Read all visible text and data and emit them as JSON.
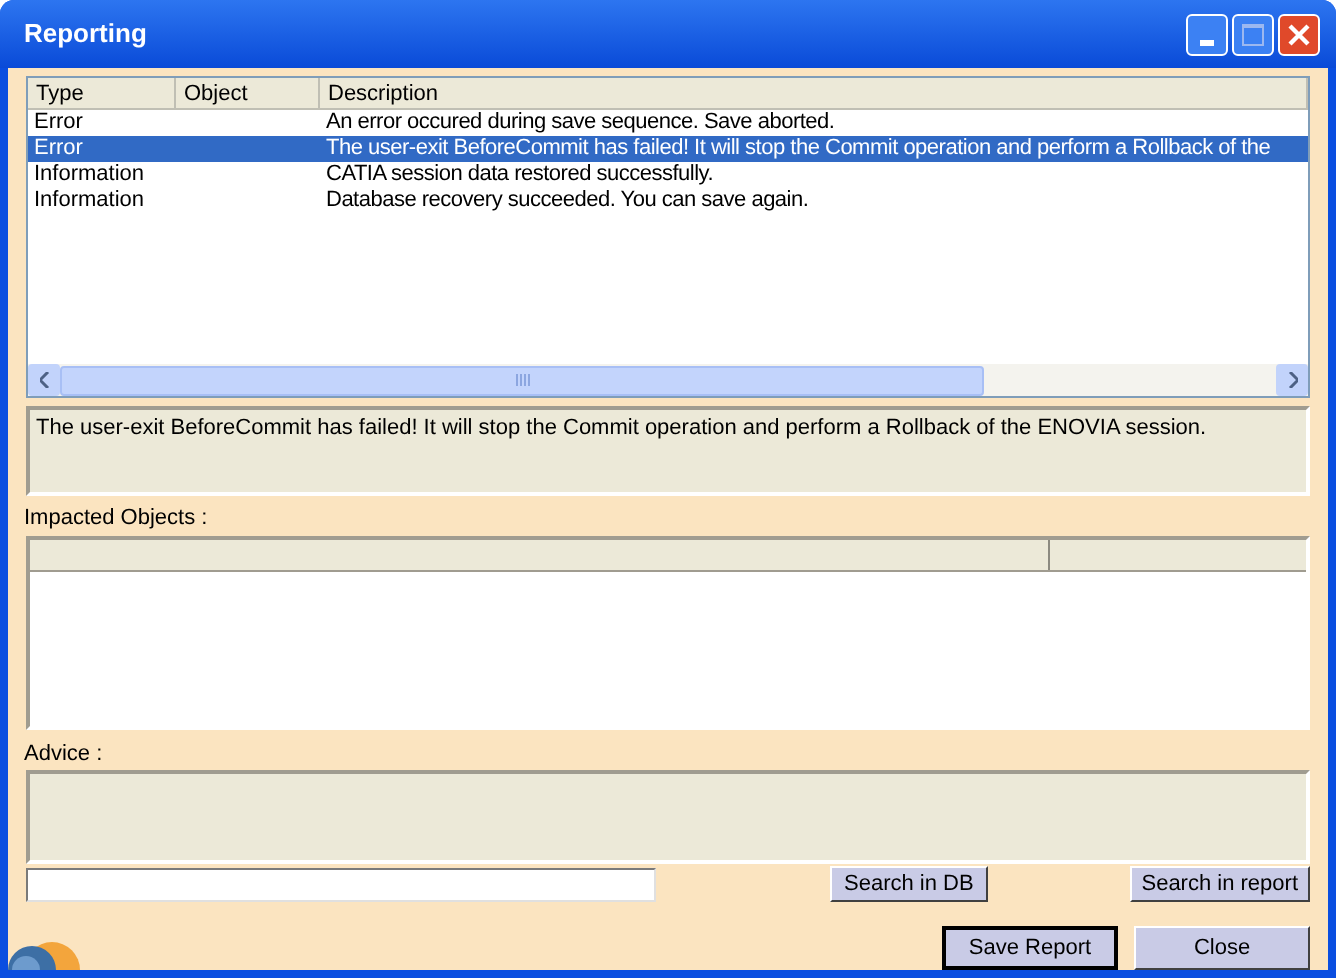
{
  "window": {
    "title": "Reporting"
  },
  "messages": {
    "columns": [
      "Type",
      "Object",
      "Description"
    ],
    "rows": [
      {
        "type": "Error",
        "description": "An error occured during save sequence. Save aborted.",
        "selected": false
      },
      {
        "type": "Error",
        "description": "The user-exit BeforeCommit has failed! It will stop the Commit operation and perform a Rollback of the",
        "selected": true
      },
      {
        "type": "Information",
        "description": "CATIA session data restored successfully.",
        "selected": false
      },
      {
        "type": "Information",
        "description": "Database recovery succeeded.  You can save again.",
        "selected": false
      }
    ]
  },
  "detail": "The user-exit BeforeCommit has failed! It will stop the Commit operation and perform a Rollback of the ENOVIA session.",
  "impacted_objects": {
    "label": "Impacted Objects :"
  },
  "advice": {
    "label": "Advice :"
  },
  "search": {
    "buttons": [
      "Search in DB",
      "Search in report"
    ]
  },
  "footer_buttons": [
    {
      "label": "Save Report",
      "default": true
    },
    {
      "label": "Close",
      "default": false
    }
  ]
}
